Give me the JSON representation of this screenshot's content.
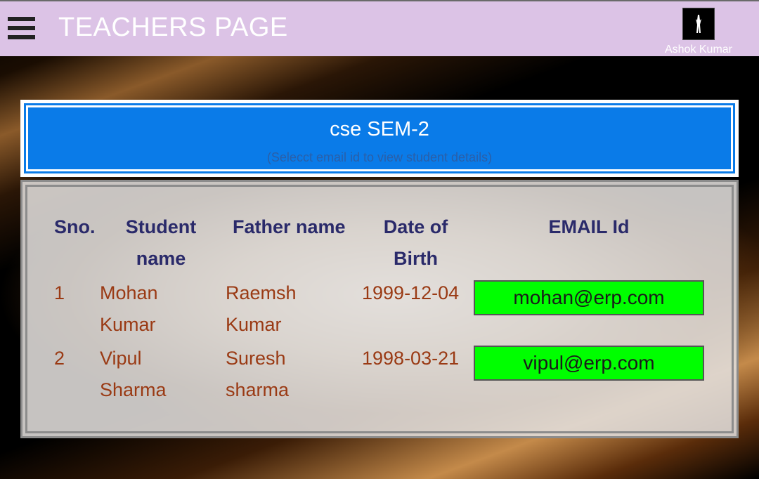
{
  "header": {
    "title": "TEACHERS PAGE",
    "user_name": "Ashok Kumar"
  },
  "class_info": {
    "title": "cse SEM-2",
    "hint": "(Selecct email id to view student details)"
  },
  "table": {
    "columns": {
      "sno": "Sno.",
      "student_name": [
        "Student",
        "name"
      ],
      "father_name": "Father name",
      "dob": [
        "Date of",
        "Birth"
      ],
      "email": "EMAIL Id"
    },
    "rows": [
      {
        "sno": "1",
        "student": [
          "Mohan",
          "Kumar"
        ],
        "father": [
          "Raemsh",
          "Kumar"
        ],
        "dob": "1999-12-04",
        "email": "mohan@erp.com"
      },
      {
        "sno": "2",
        "student": [
          "Vipul",
          "Sharma"
        ],
        "father": [
          "Suresh",
          "sharma"
        ],
        "dob": "1998-03-21",
        "email": "vipul@erp.com"
      }
    ]
  },
  "colors": {
    "topbar": "#dcc3e6",
    "accent_blue": "#0a7be8",
    "email_button": "#00ff00",
    "header_text": "#2a2a6a",
    "cell_text": "#9a3a14"
  }
}
